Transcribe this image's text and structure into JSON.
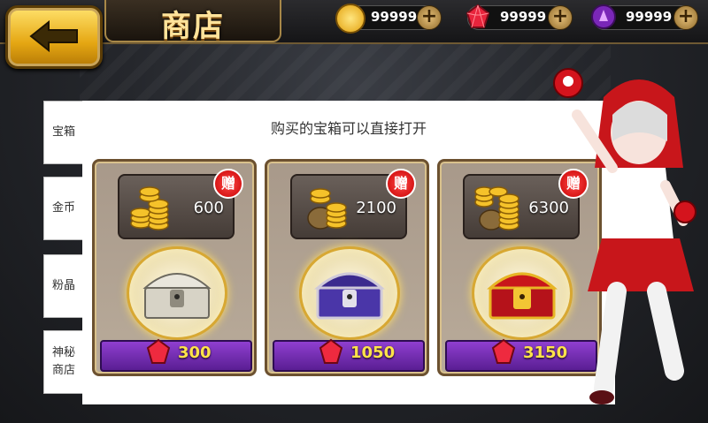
{
  "header": {
    "title": "商店",
    "resources": [
      {
        "name": "coin",
        "value": "99999",
        "color": "#f2b417"
      },
      {
        "name": "ruby",
        "value": "99999",
        "color": "#e8243c"
      },
      {
        "name": "crystal",
        "value": "99999",
        "color": "#a23de0"
      }
    ]
  },
  "tabs": [
    "宝箱",
    "金币",
    "粉晶",
    "神秘商店"
  ],
  "panel": {
    "subtitle": "购买的宝箱可以直接打开",
    "gift_label": "赠",
    "offers": [
      {
        "bonus_coins": "600",
        "price": "300",
        "chest": "silver"
      },
      {
        "bonus_coins": "2100",
        "price": "1050",
        "chest": "purple"
      },
      {
        "bonus_coins": "6300",
        "price": "3150",
        "chest": "gold"
      }
    ]
  },
  "colors": {
    "accent_gold": "#e5a713",
    "price_purple": "#6a2aa8",
    "price_text": "#ffe34a"
  }
}
